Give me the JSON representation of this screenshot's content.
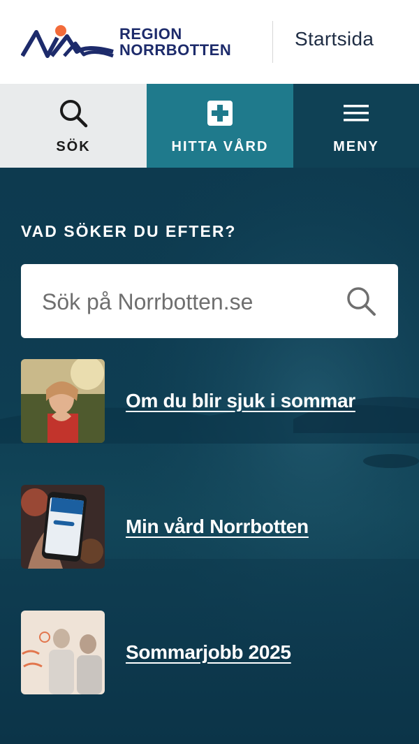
{
  "header": {
    "logo_line1": "REGION",
    "logo_line2": "NORRBOTTEN",
    "startsida": "Startsida"
  },
  "nav": {
    "sok": "SÖK",
    "hitta": "HITTA VÅRD",
    "meny": "MENY"
  },
  "main": {
    "heading": "VAD SÖKER DU EFTER?",
    "search_placeholder": "Sök på Norrbotten.se",
    "links": [
      {
        "label": "Om du blir sjuk i sommar"
      },
      {
        "label": "Min vård Norrbotten"
      },
      {
        "label": "Sommarjobb 2025"
      }
    ]
  },
  "colors": {
    "brand_navy": "#1d2b6b",
    "brand_orange": "#f26b3a",
    "teal": "#1f7a8c",
    "dark_teal": "#0f4155",
    "background": "#0e3d52"
  }
}
